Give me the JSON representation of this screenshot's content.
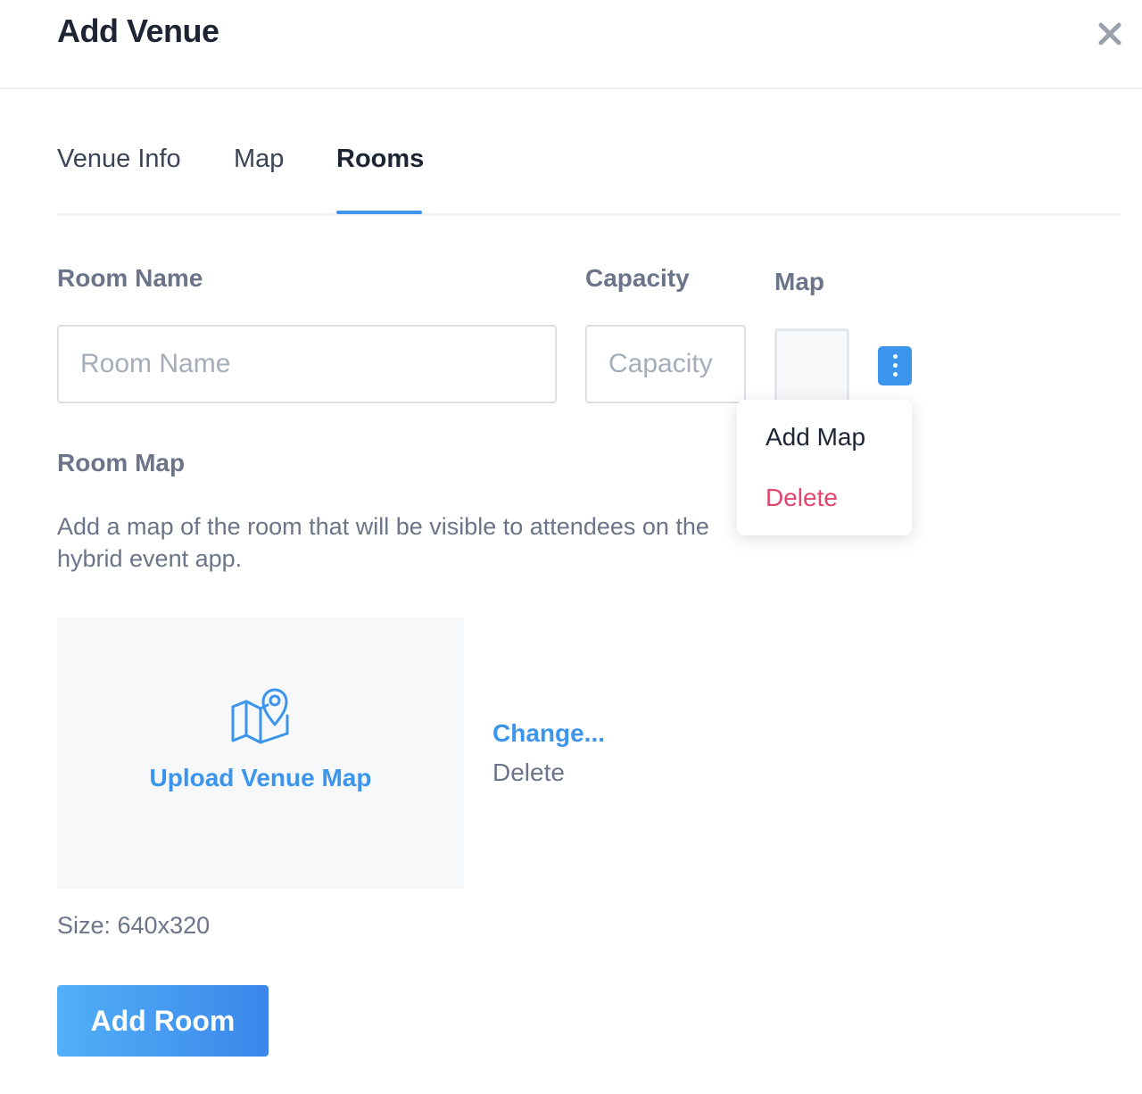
{
  "header": {
    "title": "Add Venue",
    "close_icon": "close-icon"
  },
  "tabs": [
    {
      "label": "Venue Info",
      "active": false
    },
    {
      "label": "Map",
      "active": false
    },
    {
      "label": "Rooms",
      "active": true
    }
  ],
  "form": {
    "room_name_label": "Room Name",
    "room_name_placeholder": "Room Name",
    "room_name_value": "",
    "capacity_label": "Capacity",
    "capacity_placeholder": "Capacity",
    "capacity_value": "",
    "map_label": "Map",
    "kebab_icon": "more-vertical-icon"
  },
  "dropdown": {
    "items": [
      {
        "label": "Add Map",
        "color": "#1e2433"
      },
      {
        "label": "Delete",
        "color": "#e2456c"
      }
    ]
  },
  "room_map": {
    "heading": "Room Map",
    "description": "Add a map of the room that will be visible to attendees on the hybrid event app.",
    "upload_label": "Upload Venue Map",
    "upload_icon": "map-pin-icon",
    "change_label": "Change...",
    "delete_label": "Delete",
    "size_text": "Size: 640x320"
  },
  "actions": {
    "add_room_label": "Add Room"
  },
  "colors": {
    "accent": "#3b95ec",
    "danger": "#e2456c",
    "muted": "#6b7488",
    "heading": "#1e2433"
  }
}
